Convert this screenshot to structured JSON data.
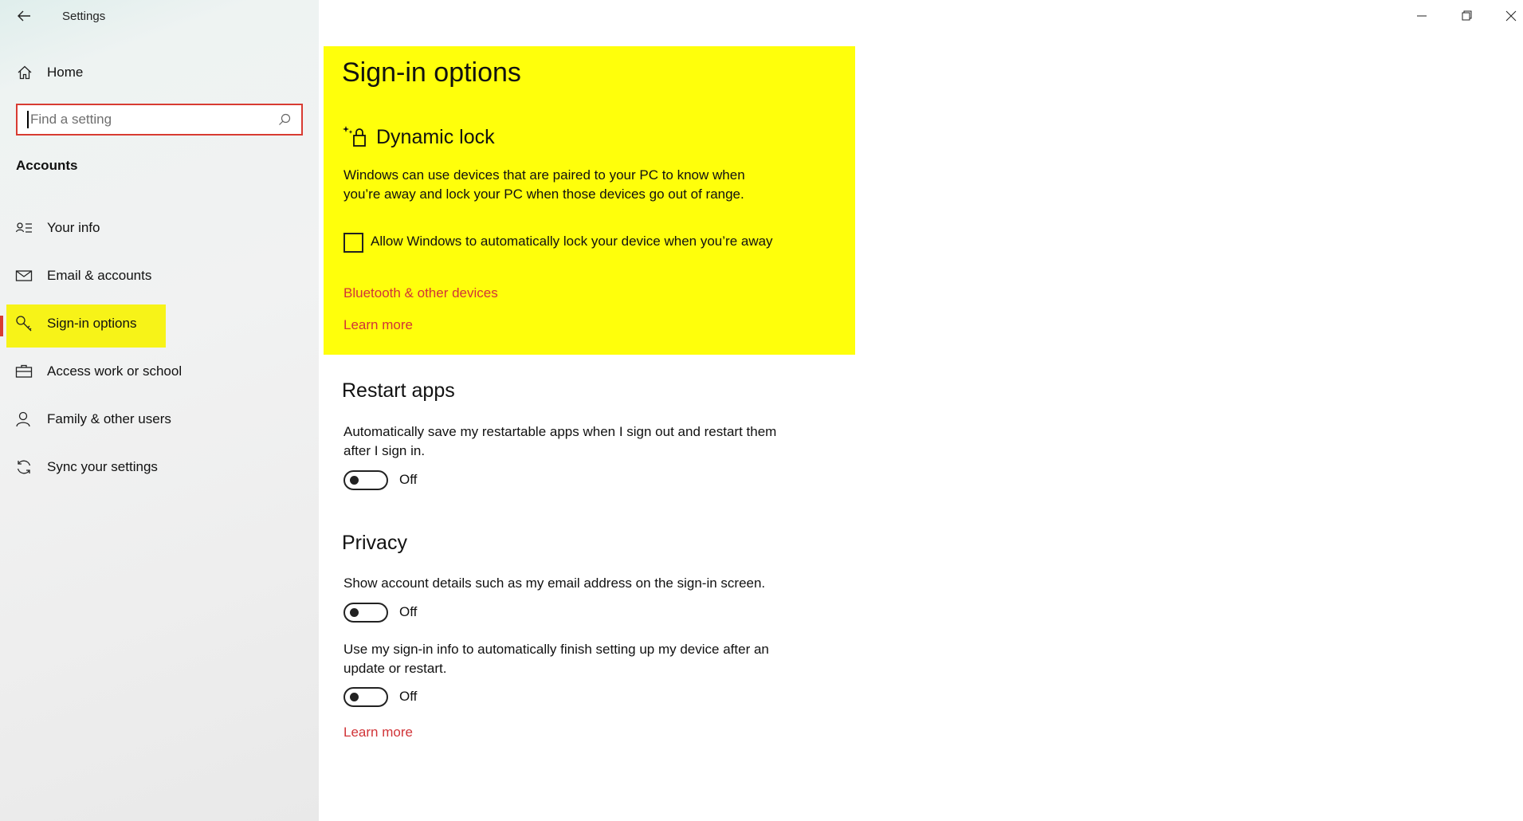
{
  "window": {
    "title": "Settings",
    "controls": [
      "minimize",
      "restore",
      "close"
    ]
  },
  "sidebar": {
    "home_label": "Home",
    "search_placeholder": "Find a setting",
    "section_title": "Accounts",
    "items": [
      {
        "label": "Your info",
        "icon": "person-card-icon",
        "active": false
      },
      {
        "label": "Email & accounts",
        "icon": "mail-icon",
        "active": false
      },
      {
        "label": "Sign-in options",
        "icon": "key-icon",
        "active": true
      },
      {
        "label": "Access work or school",
        "icon": "briefcase-icon",
        "active": false
      },
      {
        "label": "Family & other users",
        "icon": "person-add-icon",
        "active": false
      },
      {
        "label": "Sync your settings",
        "icon": "sync-icon",
        "active": false
      }
    ]
  },
  "main": {
    "page_title": "Sign-in options",
    "dynamic_lock": {
      "title": "Dynamic lock",
      "description": "Windows can use devices that are paired to your PC to know when you’re away and lock your PC when those devices go out of range.",
      "checkbox_label": "Allow Windows to automatically lock your device when you’re away",
      "checkbox_checked": false,
      "link_bluetooth": "Bluetooth & other devices",
      "link_learn_more": "Learn more"
    },
    "restart_apps": {
      "title": "Restart apps",
      "description": "Automatically save my restartable apps when I sign out and restart them after I sign in.",
      "toggle_state": "Off"
    },
    "privacy": {
      "title": "Privacy",
      "setting1_description": "Show account details such as my email address on the sign-in screen.",
      "setting1_state": "Off",
      "setting2_description": "Use my sign-in info to automatically finish setting up my device after an update or restart.",
      "setting2_state": "Off",
      "link_learn_more": "Learn more"
    }
  },
  "colors": {
    "accent_link": "#d13438",
    "highlight": "#ffff0b",
    "active_marker": "#d83b32"
  }
}
